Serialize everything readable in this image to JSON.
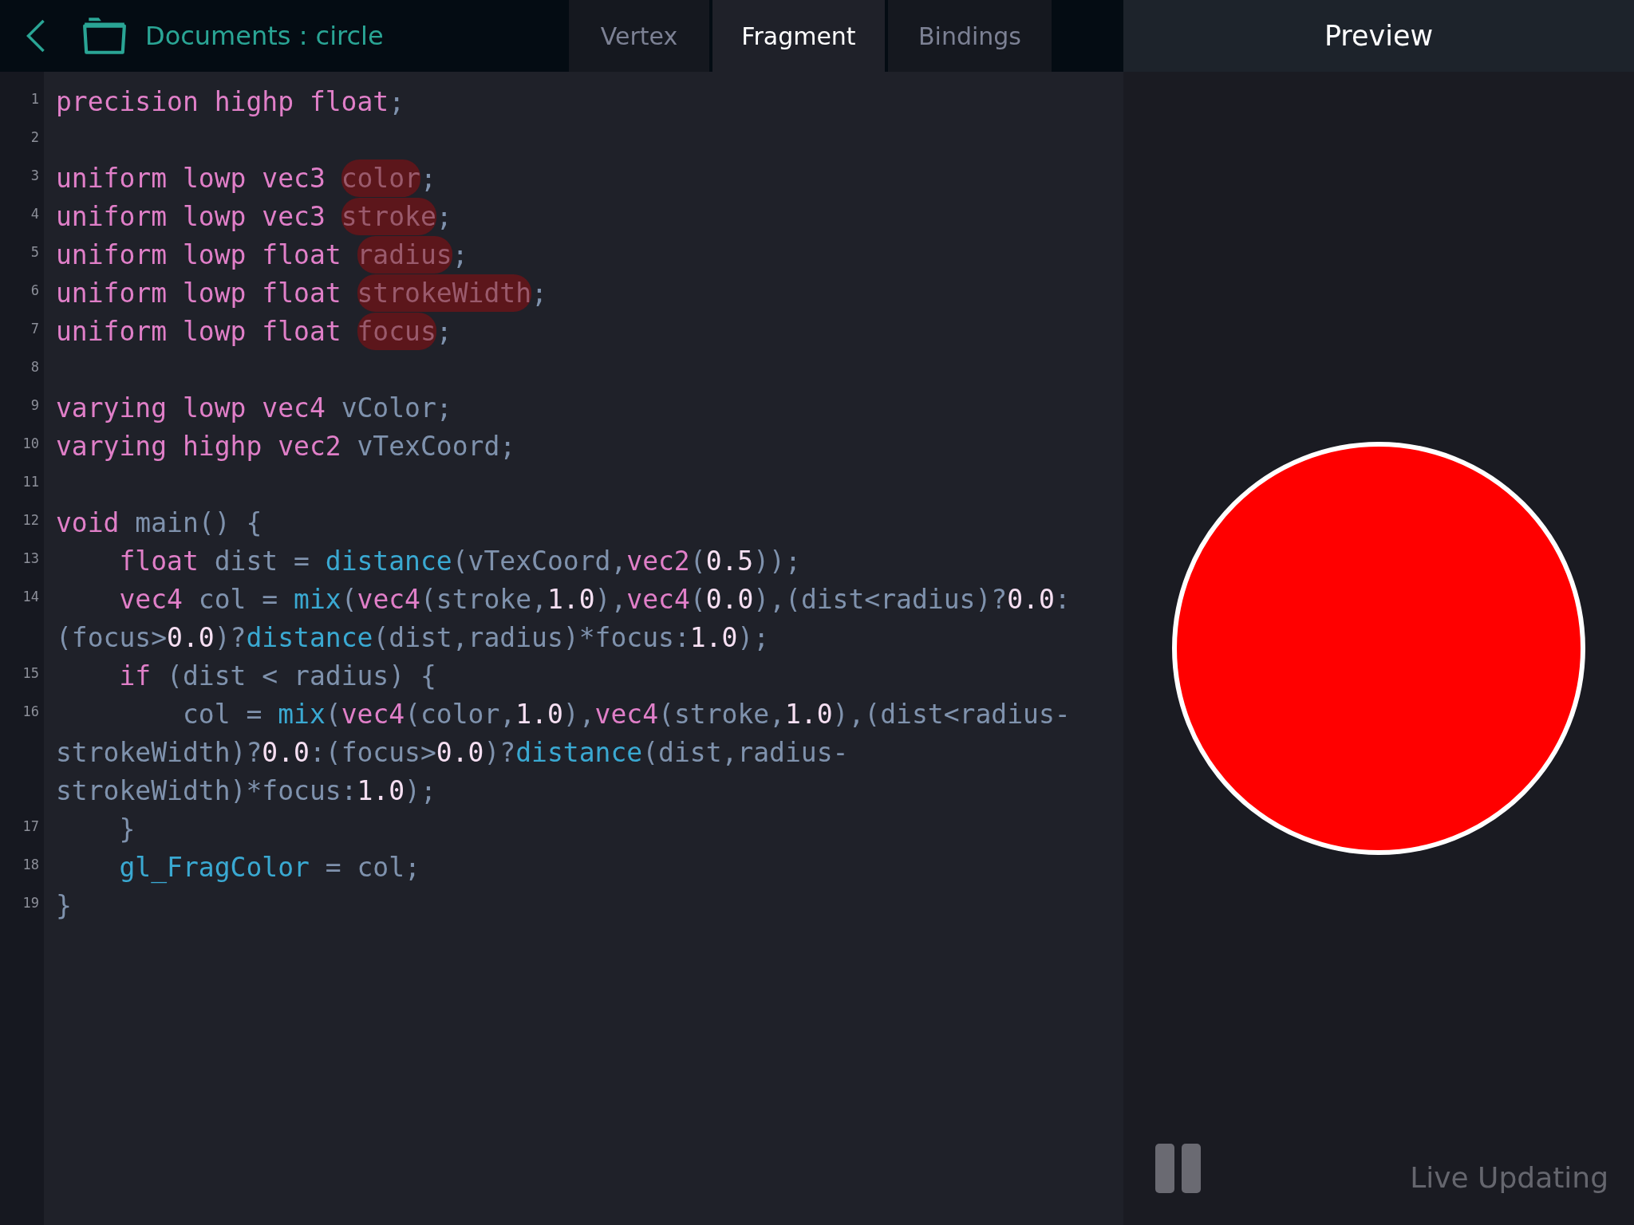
{
  "header": {
    "title": "Documents : circle"
  },
  "tabs": [
    {
      "label": "Vertex",
      "selected": false
    },
    {
      "label": "Fragment",
      "selected": true
    },
    {
      "label": "Bindings",
      "selected": false
    }
  ],
  "preview": {
    "title": "Preview",
    "status": "Live Updating"
  },
  "code": [
    {
      "number": "1",
      "wraps": [
        {
          "segments": [
            {
              "kind": "kw",
              "text": "precision highp float"
            },
            {
              "kind": "id",
              "text": ";"
            }
          ]
        }
      ]
    },
    {
      "number": "2"
    },
    {
      "number": "3",
      "wraps": [
        {
          "segments": [
            {
              "kind": "kw",
              "text": "uniform lowp vec3 "
            },
            {
              "kind": "uni",
              "text": "color"
            },
            {
              "kind": "id",
              "text": ";"
            }
          ]
        }
      ]
    },
    {
      "number": "4",
      "wraps": [
        {
          "segments": [
            {
              "kind": "kw",
              "text": "uniform lowp vec3 "
            },
            {
              "kind": "uni",
              "text": "stroke"
            },
            {
              "kind": "id",
              "text": ";"
            }
          ]
        }
      ]
    },
    {
      "number": "5",
      "wraps": [
        {
          "segments": [
            {
              "kind": "kw",
              "text": "uniform lowp float "
            },
            {
              "kind": "uni",
              "text": "radius"
            },
            {
              "kind": "id",
              "text": ";"
            }
          ]
        }
      ]
    },
    {
      "number": "6",
      "wraps": [
        {
          "segments": [
            {
              "kind": "kw",
              "text": "uniform lowp float "
            },
            {
              "kind": "uni",
              "text": "strokeWidth"
            },
            {
              "kind": "id",
              "text": ";"
            }
          ]
        }
      ]
    },
    {
      "number": "7",
      "wraps": [
        {
          "segments": [
            {
              "kind": "kw",
              "text": "uniform lowp float "
            },
            {
              "kind": "uni",
              "text": "focus"
            },
            {
              "kind": "id",
              "text": ";"
            }
          ]
        }
      ]
    },
    {
      "number": "8"
    },
    {
      "number": "9",
      "wraps": [
        {
          "segments": [
            {
              "kind": "kw",
              "text": "varying lowp vec4 "
            },
            {
              "kind": "id",
              "text": "vColor;"
            }
          ]
        }
      ]
    },
    {
      "number": "10",
      "wraps": [
        {
          "segments": [
            {
              "kind": "kw",
              "text": "varying highp vec2 "
            },
            {
              "kind": "id",
              "text": "vTexCoord;"
            }
          ]
        }
      ]
    },
    {
      "number": "11"
    },
    {
      "number": "12",
      "wraps": [
        {
          "segments": [
            {
              "kind": "kw",
              "text": "void"
            },
            {
              "kind": "id",
              "text": " main() {"
            }
          ]
        }
      ]
    },
    {
      "number": "13",
      "wraps": [
        {
          "segments": [
            {
              "kind": "kw",
              "text": "    float"
            },
            {
              "kind": "id",
              "text": " dist = "
            },
            {
              "kind": "fn",
              "text": "distance"
            },
            {
              "kind": "id",
              "text": "(vTexCoord,"
            },
            {
              "kind": "kw",
              "text": "vec2"
            },
            {
              "kind": "id",
              "text": "("
            },
            {
              "kind": "num",
              "text": "0.5"
            },
            {
              "kind": "id",
              "text": "));"
            }
          ]
        }
      ]
    },
    {
      "number": "14",
      "wraps": [
        {
          "segments": [
            {
              "kind": "kw",
              "text": "    vec4"
            },
            {
              "kind": "id",
              "text": " col = "
            },
            {
              "kind": "fn",
              "text": "mix"
            },
            {
              "kind": "id",
              "text": "("
            },
            {
              "kind": "kw",
              "text": "vec4"
            },
            {
              "kind": "id",
              "text": "(stroke,"
            },
            {
              "kind": "num",
              "text": "1.0"
            },
            {
              "kind": "id",
              "text": "),"
            },
            {
              "kind": "kw",
              "text": "vec4"
            },
            {
              "kind": "id",
              "text": "("
            },
            {
              "kind": "num",
              "text": "0.0"
            },
            {
              "kind": "id",
              "text": "),(dist<radius)?"
            },
            {
              "kind": "num",
              "text": "0.0"
            },
            {
              "kind": "id",
              "text": ":"
            }
          ]
        },
        {
          "segments": [
            {
              "kind": "id",
              "text": "(focus>"
            },
            {
              "kind": "num",
              "text": "0.0"
            },
            {
              "kind": "id",
              "text": ")?"
            },
            {
              "kind": "fn",
              "text": "distance"
            },
            {
              "kind": "id",
              "text": "(dist,radius)*focus:"
            },
            {
              "kind": "num",
              "text": "1.0"
            },
            {
              "kind": "id",
              "text": ");"
            }
          ]
        }
      ]
    },
    {
      "number": "15",
      "wraps": [
        {
          "segments": [
            {
              "kind": "kw",
              "text": "    if"
            },
            {
              "kind": "id",
              "text": " (dist < radius) {"
            }
          ]
        }
      ]
    },
    {
      "number": "16",
      "wraps": [
        {
          "segments": [
            {
              "kind": "id",
              "text": "        col = "
            },
            {
              "kind": "fn",
              "text": "mix"
            },
            {
              "kind": "id",
              "text": "("
            },
            {
              "kind": "kw",
              "text": "vec4"
            },
            {
              "kind": "id",
              "text": "(color,"
            },
            {
              "kind": "num",
              "text": "1.0"
            },
            {
              "kind": "id",
              "text": "),"
            },
            {
              "kind": "kw",
              "text": "vec4"
            },
            {
              "kind": "id",
              "text": "(stroke,"
            },
            {
              "kind": "num",
              "text": "1.0"
            },
            {
              "kind": "id",
              "text": "),(dist<radius-"
            }
          ]
        },
        {
          "segments": [
            {
              "kind": "id",
              "text": "strokeWidth)?"
            },
            {
              "kind": "num",
              "text": "0.0"
            },
            {
              "kind": "id",
              "text": ":(focus>"
            },
            {
              "kind": "num",
              "text": "0.0"
            },
            {
              "kind": "id",
              "text": ")?"
            },
            {
              "kind": "fn",
              "text": "distance"
            },
            {
              "kind": "id",
              "text": "(dist,radius-"
            }
          ]
        },
        {
          "segments": [
            {
              "kind": "id",
              "text": "strokeWidth)*focus:"
            },
            {
              "kind": "num",
              "text": "1.0"
            },
            {
              "kind": "id",
              "text": ");"
            }
          ]
        }
      ]
    },
    {
      "number": "17",
      "wraps": [
        {
          "segments": [
            {
              "kind": "id",
              "text": "    }"
            }
          ]
        }
      ]
    },
    {
      "number": "18",
      "wraps": [
        {
          "segments": [
            {
              "kind": "fn",
              "text": "    gl_FragColor"
            },
            {
              "kind": "id",
              "text": " = col;"
            }
          ]
        }
      ]
    },
    {
      "number": "19",
      "wraps": [
        {
          "segments": [
            {
              "kind": "id",
              "text": "}"
            }
          ]
        }
      ]
    }
  ]
}
